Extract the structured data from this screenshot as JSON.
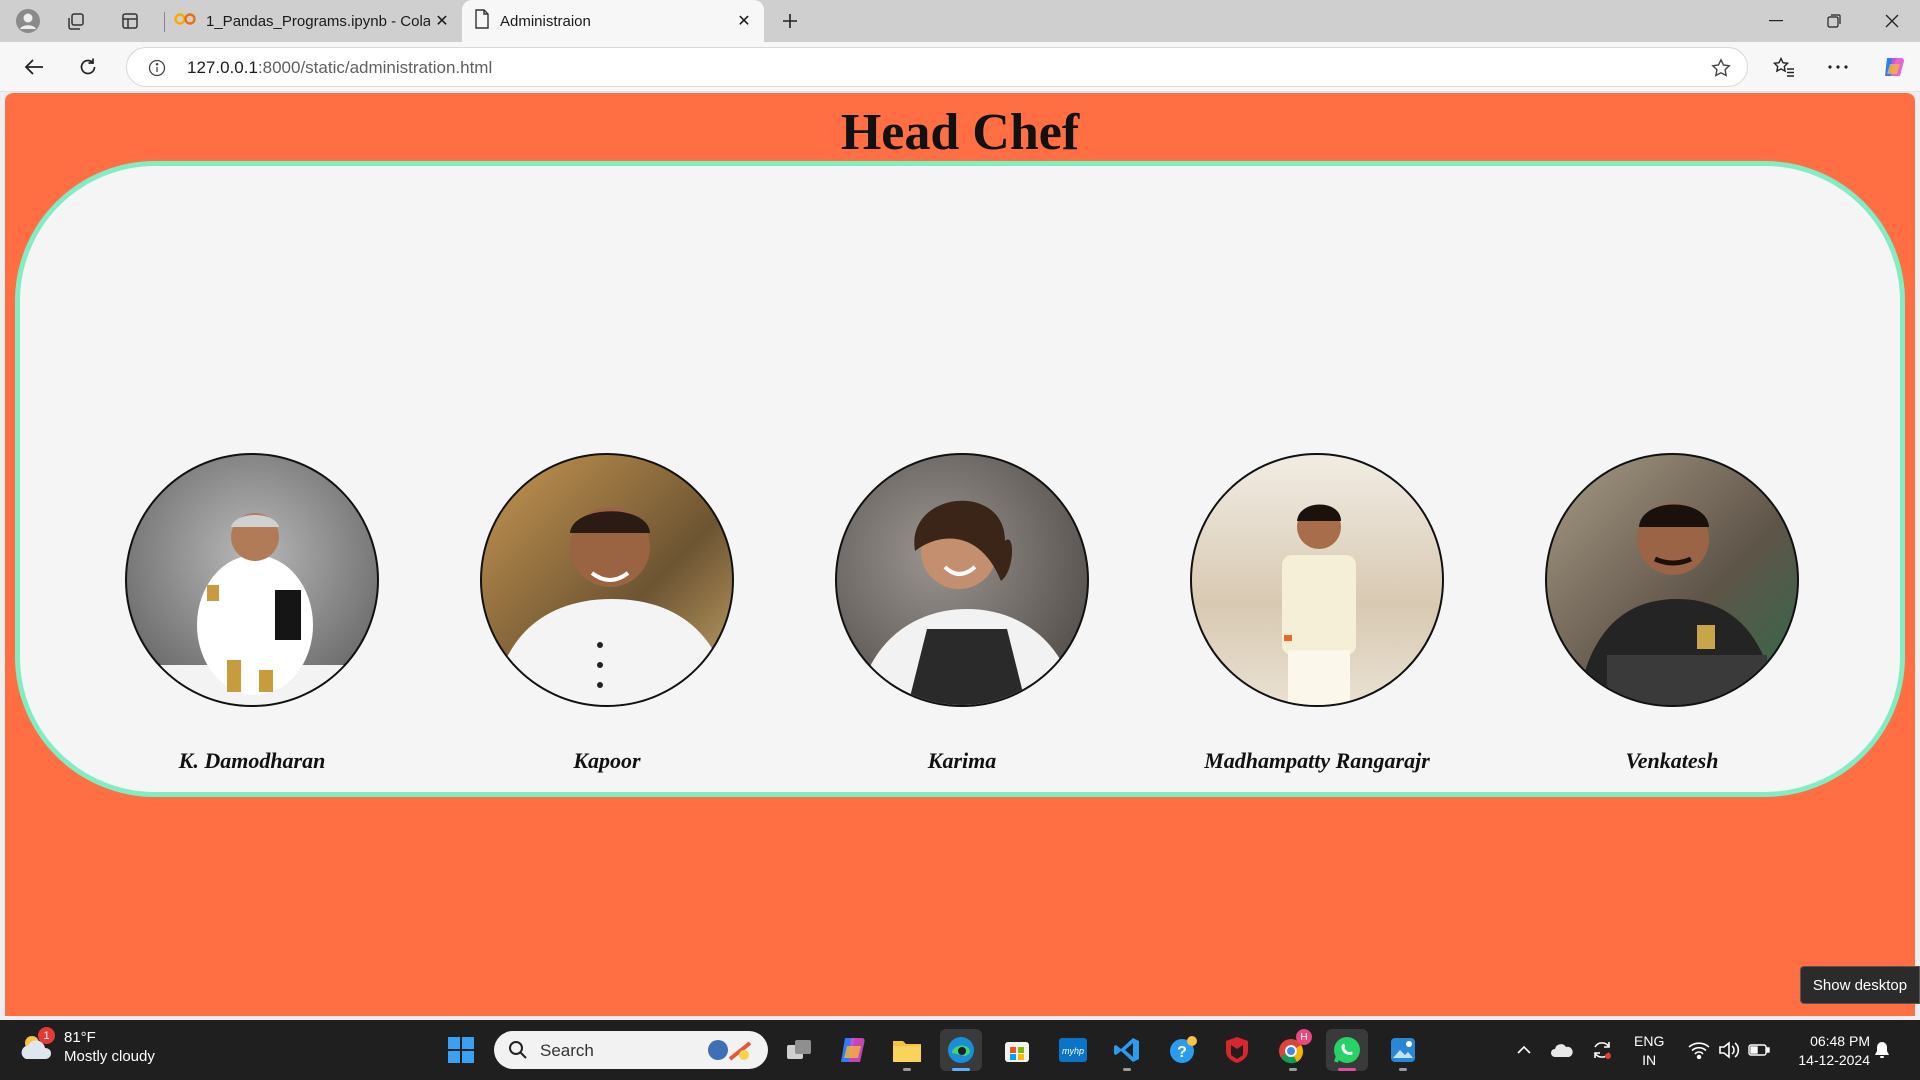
{
  "browser": {
    "tabs": [
      {
        "title": "1_Pandas_Programs.ipynb - Colab",
        "icon": "colab-icon"
      },
      {
        "title": "Administraion",
        "icon": "page-icon",
        "active": true
      }
    ],
    "url_host": "127.0.0.1",
    "url_path": ":8000/static/administration.html"
  },
  "page": {
    "title": "Head Chef",
    "background": "#ff6f43",
    "card_border": "#7feec2",
    "chefs": [
      {
        "name": "K. Damodharan"
      },
      {
        "name": "Kapoor"
      },
      {
        "name": "Karima"
      },
      {
        "name": "Madhampatty Rangarajr"
      },
      {
        "name": "Venkatesh"
      }
    ]
  },
  "show_desktop": "Show desktop",
  "taskbar": {
    "weather_badge": "1",
    "temperature": "81°F",
    "condition": "Mostly cloudy",
    "search_placeholder": "Search",
    "lang_line1": "ENG",
    "lang_line2": "IN",
    "time": "06:48 PM",
    "date": "14-12-2024",
    "chrome_badge": "H"
  }
}
